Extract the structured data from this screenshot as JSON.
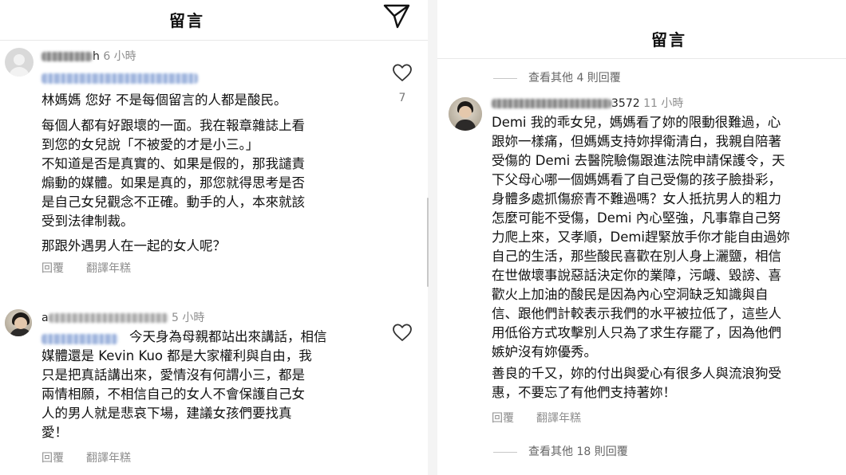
{
  "left": {
    "header": {
      "title": "留言"
    },
    "comment1": {
      "username_tail": "h",
      "time": "6 小時",
      "lines": [
        "林媽媽 您好 不是每個留言的人都是酸民。",
        "每個人都有好跟壞的一面。我在報章雜誌上看",
        "到您的女兒說「不被愛的才是小三。」",
        "不知道是否是真實的、如果是假的，那我譴責",
        "煽動的媒體。如果是真的，那您就得思考是否",
        "是自己女兒觀念不正確。動手的人，本來就該",
        "受到法律制裁。",
        "那跟外遇男人在一起的女人呢？"
      ],
      "reply_label": "回覆",
      "translate_label": "翻譯年糕",
      "like_count": "7"
    },
    "comment2": {
      "username_head": "a",
      "time": "5 小時",
      "lines": [
        "今天身為母親都站出來講話，相信",
        "媒體還是 Kevin Kuo 都是大家權利與自由，我",
        "只是把真話講出來，愛情沒有何謂小三，都是",
        "兩情相願，不相信自己的女人不會保護自己女",
        "人的男人就是悲哀下場，建議女孩們要找真",
        "愛！"
      ],
      "reply_label": "回覆",
      "translate_label": "翻譯年糕"
    }
  },
  "right": {
    "header": {
      "title": "留言"
    },
    "view_more_top": "查看其他 4 則回覆",
    "comment": {
      "username_tail": "3572",
      "time": "11 小時",
      "lines": [
        "Demi 我的乖女兒，媽媽看了妳的限動很難過，心",
        "跟妳一樣痛，但媽媽支持妳捍衛清白，我親自陪著",
        "受傷的 Demi 去醫院驗傷跟進法院申請保護令，天",
        "下父母心哪一個媽媽看了自己受傷的孩子臉掛彩，",
        "身體多處抓傷瘀青不難過嗎？女人抵抗男人的粗力",
        "怎麼可能不受傷，Demi 內心堅強，凡事靠自己努",
        "力爬上來，又孝順，Demi趕緊放手你才能自由過妳",
        "自己的生活，那些酸民喜歡在別人身上灑鹽，相信",
        "在世做壞事說惡話決定你的業障，污衊、毀謗、喜",
        "歡火上加油的酸民是因為內心空洞缺乏知識與自",
        "信、跟他們計較表示我們的水平被拉低了，這些人",
        "用低俗方式攻擊別人只為了求生存罷了，因為他們",
        "嫉妒沒有妳優秀。",
        "善良的千又，妳的付出與愛心有很多人與流浪狗受",
        "惠，不要忘了有他們支持著妳！"
      ],
      "reply_label": "回覆",
      "translate_label": "翻譯年糕"
    },
    "view_more_bottom": "查看其他 18 則回覆"
  }
}
